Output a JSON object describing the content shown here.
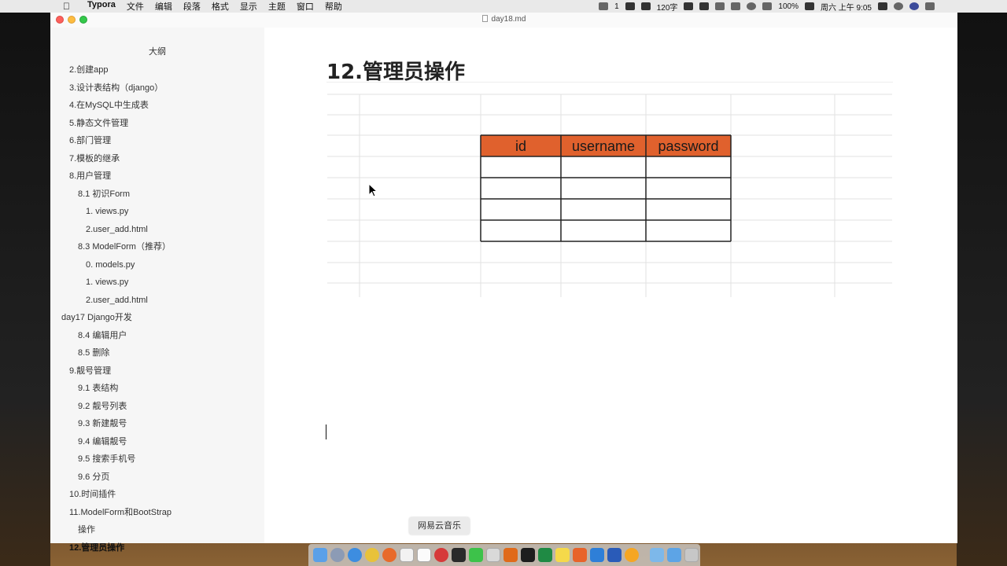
{
  "menubar": {
    "app_name": "Typora",
    "items": [
      "文件",
      "编辑",
      "段落",
      "格式",
      "显示",
      "主题",
      "窗口",
      "帮助"
    ],
    "status": {
      "wechat_count": "1",
      "word_count": "120字",
      "battery": "100%",
      "datetime": "周六 上午 9:05"
    }
  },
  "window": {
    "title": "day18.md"
  },
  "sidebar": {
    "title": "大纲",
    "items": [
      {
        "label": "2.创建app",
        "level": 2
      },
      {
        "label": "3.设计表结构（django）",
        "level": 2
      },
      {
        "label": "4.在MySQL中生成表",
        "level": 2
      },
      {
        "label": "5.静态文件管理",
        "level": 2
      },
      {
        "label": "6.部门管理",
        "level": 2
      },
      {
        "label": "7.模板的继承",
        "level": 2
      },
      {
        "label": "8.用户管理",
        "level": 2
      },
      {
        "label": "8.1 初识Form",
        "level": 3
      },
      {
        "label": "1. views.py",
        "level": 4
      },
      {
        "label": "2.user_add.html",
        "level": 4
      },
      {
        "label": "8.3 ModelForm（推荐）",
        "level": 3
      },
      {
        "label": "0. models.py",
        "level": 4
      },
      {
        "label": "1. views.py",
        "level": 4
      },
      {
        "label": "2.user_add.html",
        "level": 4
      },
      {
        "label": "day17 Django开发",
        "level": 1
      },
      {
        "label": "8.4 编辑用户",
        "level": 3
      },
      {
        "label": "8.5 删除",
        "level": 3
      },
      {
        "label": "9.靓号管理",
        "level": 2
      },
      {
        "label": "9.1 表结构",
        "level": 3
      },
      {
        "label": "9.2 靓号列表",
        "level": 3
      },
      {
        "label": "9.3 新建靓号",
        "level": 3
      },
      {
        "label": "9.4 编辑靓号",
        "level": 3
      },
      {
        "label": "9.5 搜索手机号",
        "level": 3
      },
      {
        "label": "9.6 分页",
        "level": 3
      },
      {
        "label": "10.时间插件",
        "level": 2
      },
      {
        "label": "11.ModelForm和BootStrap",
        "level": 2
      },
      {
        "label": "操作",
        "level": 3
      },
      {
        "label": "12.管理员操作",
        "level": 2,
        "active": true
      }
    ]
  },
  "editor": {
    "heading": "12.管理员操作",
    "table": {
      "headers": [
        "id",
        "username",
        "password"
      ],
      "rows": [
        [
          "",
          "",
          ""
        ],
        [
          "",
          "",
          ""
        ],
        [
          "",
          "",
          ""
        ],
        [
          "",
          "",
          ""
        ]
      ],
      "header_color": "#e0612d"
    }
  },
  "notification": {
    "text": "网易云音乐"
  },
  "dock": {
    "icons": [
      "finder-icon",
      "launchpad-icon",
      "safari-icon",
      "chrome-icon",
      "firefox-icon",
      "typora-icon",
      "calendar-icon",
      "netease-music-icon",
      "pycharm-icon",
      "wechat-icon",
      "preview-icon",
      "sublime-icon",
      "terminal-icon",
      "excel-icon",
      "notes-icon",
      "navicat-icon",
      "xcode-icon",
      "word-icon",
      "qq-icon",
      "folder-icon",
      "downloads-icon",
      "trash-icon"
    ]
  }
}
